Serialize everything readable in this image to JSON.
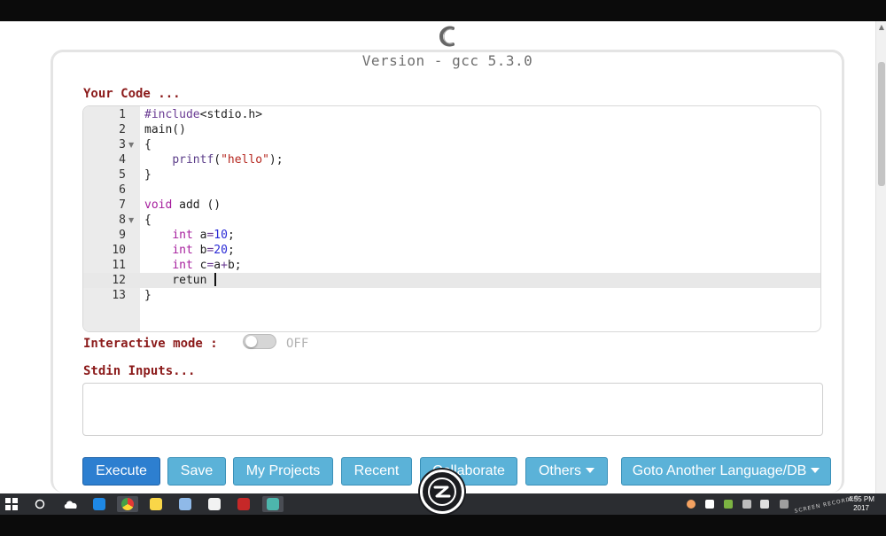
{
  "header": {
    "version": "Version - gcc 5.3.0"
  },
  "editor": {
    "label": "Your Code ...",
    "lines": [
      {
        "n": "1",
        "text": "#include<stdio.h>"
      },
      {
        "n": "2",
        "text": "main()"
      },
      {
        "n": "3",
        "text": "{"
      },
      {
        "n": "4",
        "text": "    printf(\"hello\");"
      },
      {
        "n": "5",
        "text": "}"
      },
      {
        "n": "6",
        "text": ""
      },
      {
        "n": "7",
        "text": "void add ()"
      },
      {
        "n": "8",
        "text": "{"
      },
      {
        "n": "9",
        "text": "    int a=10;"
      },
      {
        "n": "10",
        "text": "    int b=20;"
      },
      {
        "n": "11",
        "text": "    int c=a+b;"
      },
      {
        "n": "12",
        "text": "    retun "
      },
      {
        "n": "13",
        "text": "}"
      }
    ],
    "fold_lines": [
      3,
      8
    ],
    "active_line": 12
  },
  "interactive": {
    "label": "Interactive mode :",
    "state": "OFF"
  },
  "stdin": {
    "label": "Stdin Inputs...",
    "value": ""
  },
  "buttons": {
    "execute": "Execute",
    "save": "Save",
    "my_projects": "My Projects",
    "recent": "Recent",
    "collaborate": "Collaborate",
    "others": "Others",
    "goto": "Goto Another Language/DB"
  },
  "taskbar": {
    "time": "4:55 PM",
    "date": "2017",
    "recorder": "SCREEN RECORDER"
  },
  "colors": {
    "label": "#8b1a1a",
    "primary_button": "#2d7fd0",
    "button": "#5bb2d8",
    "keyword": "#a61e9d",
    "string": "#b5261e",
    "number": "#2a2ad6"
  }
}
